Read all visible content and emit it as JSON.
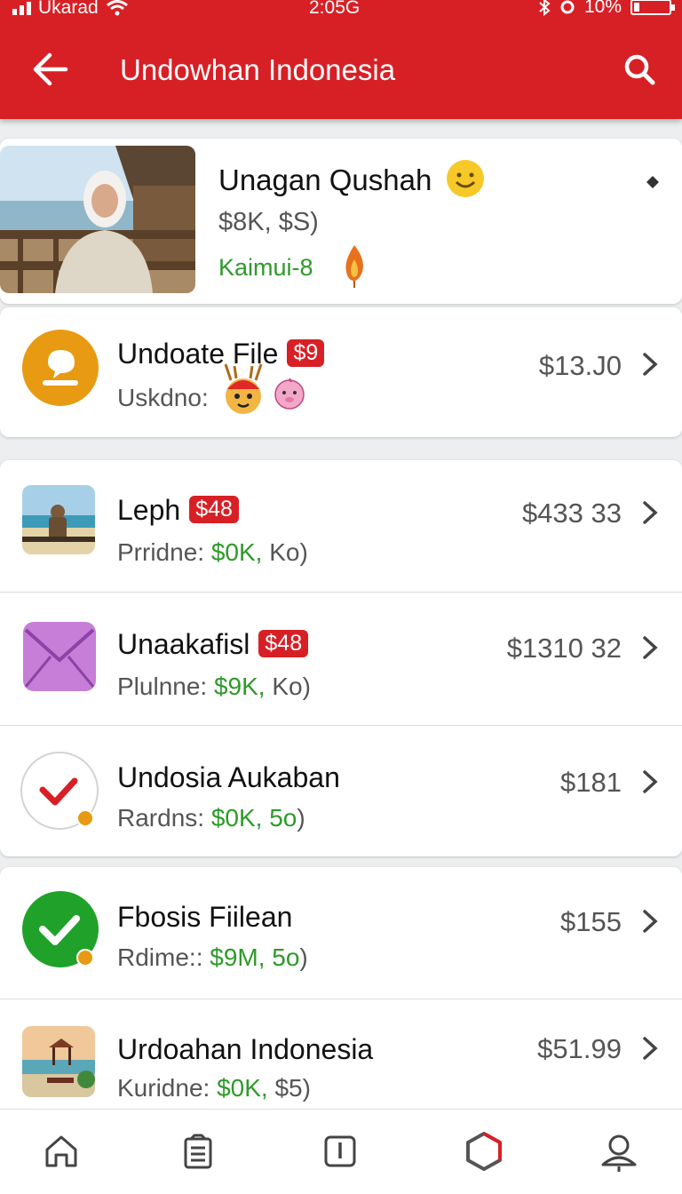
{
  "status_bar": {
    "carrier": "Ukarad",
    "time": "2:05G",
    "battery": "10%"
  },
  "header": {
    "title": "Undowhan Indonesia"
  },
  "featured": {
    "name": "Unagan Qushah",
    "price_line": "$8K, $S)",
    "tag": "Kaimui-8"
  },
  "items": [
    {
      "title": "Undoate File",
      "badge": "$9",
      "subtitle_label": "Uskdno:",
      "subtitle_value": "",
      "subtitle_extra": "",
      "price": "$13.J0",
      "icon": "chat-bubble-icon"
    },
    {
      "title": "Leph",
      "badge": "$48",
      "subtitle_label": "Prridne:",
      "subtitle_value": "$0K,",
      "subtitle_extra": "Ko)",
      "price": "$433 33",
      "icon": "beach-photo-icon"
    },
    {
      "title": "Unaakafisl",
      "badge": "$48",
      "subtitle_label": "Plulnne:",
      "subtitle_value": "$9K,",
      "subtitle_extra": "Ko)",
      "price": "$1310 32",
      "icon": "envelope-icon"
    },
    {
      "title": "Undosia Aukaban",
      "badge": "",
      "subtitle_label": "Rardns:",
      "subtitle_value": "$0K, 5o",
      "subtitle_extra": ")",
      "price": "$181",
      "icon": "checkmark-outline-icon"
    },
    {
      "title": "Fbosis Fiilean",
      "badge": "",
      "subtitle_label": "Rdime::",
      "subtitle_value": "$9M, 5o",
      "subtitle_extra": ")",
      "price": "$155",
      "icon": "checkmark-filled-icon"
    },
    {
      "title": "Urdoahan Indonesia",
      "badge": "",
      "subtitle_label": "Kuridne:",
      "subtitle_value": "$0K,",
      "subtitle_extra": "$5)",
      "price": "$51.99",
      "icon": "beach-hut-photo-icon"
    }
  ],
  "nav": [
    "home-icon",
    "list-icon",
    "timer-icon",
    "hexagon-icon",
    "profile-icon"
  ],
  "colors": {
    "brand_red": "#d72026",
    "green": "#2e9a2a",
    "orange": "#e79a12"
  }
}
